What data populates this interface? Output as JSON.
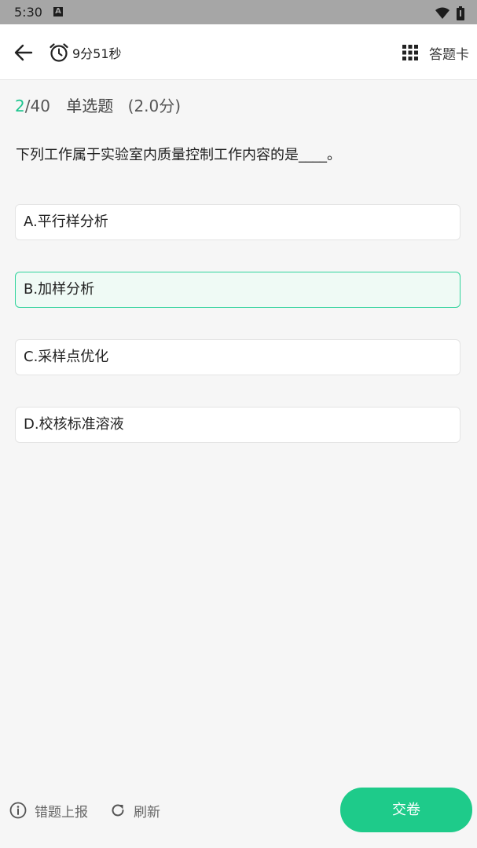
{
  "status_bar": {
    "time": "5:30",
    "notification_icon": "a-icon",
    "icons": [
      "wifi-icon",
      "battery-icon"
    ]
  },
  "app_bar": {
    "back_icon": "arrow-left-icon",
    "timer_icon": "alarm-clock-icon",
    "timer_text": "9分51秒",
    "card_icon": "grid-icon",
    "card_label": "答题卡"
  },
  "question": {
    "current": "2",
    "total": "/40",
    "type": "单选题",
    "score": "(2.0分)",
    "stem": "下列工作属于实验室内质量控制工作内容的是____。",
    "options": [
      {
        "label": "A.平行样分析",
        "selected": false
      },
      {
        "label": "B.加样分析",
        "selected": true
      },
      {
        "label": "C.采样点优化",
        "selected": false
      },
      {
        "label": "D.校核标准溶液",
        "selected": false
      }
    ]
  },
  "footer": {
    "report_icon": "info-circle-icon",
    "report_label": "错题上报",
    "refresh_icon": "refresh-icon",
    "refresh_label": "刷新",
    "submit_label": "交卷"
  },
  "colors": {
    "accent": "#1ecb8a",
    "selected_bg": "#effaf5",
    "selected_border": "#2fd39b"
  }
}
